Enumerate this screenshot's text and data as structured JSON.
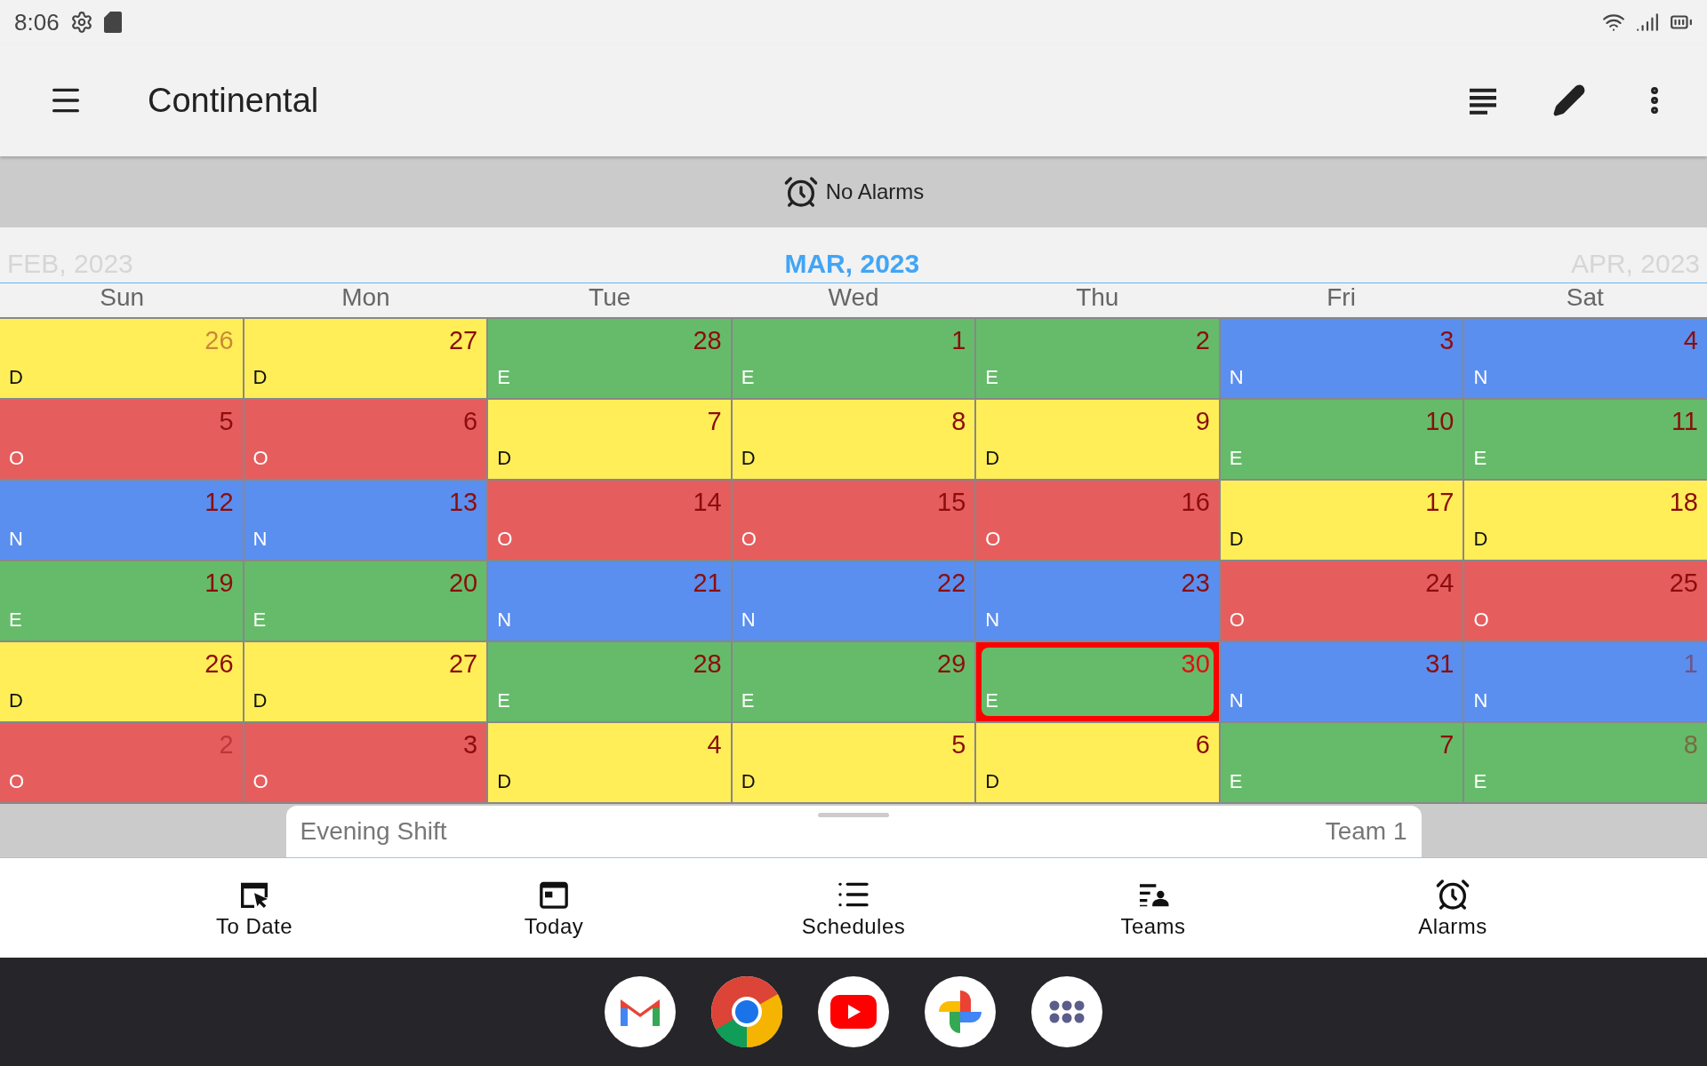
{
  "status_bar": {
    "time": "8:06"
  },
  "app_bar": {
    "title": "Continental"
  },
  "alarm_banner": {
    "text": "No Alarms"
  },
  "month_header": {
    "previous": "FEB, 2023",
    "current": "MAR, 2023",
    "next": "APR, 2023"
  },
  "weekdays": [
    "Sun",
    "Mon",
    "Tue",
    "Wed",
    "Thu",
    "Fri",
    "Sat"
  ],
  "days": [
    {
      "day": "26",
      "shift": "D",
      "color": "#ffee58",
      "faded": true,
      "selected": false
    },
    {
      "day": "27",
      "shift": "D",
      "color": "#ffee58",
      "faded": false,
      "selected": false
    },
    {
      "day": "28",
      "shift": "E",
      "color": "#66bb6a",
      "faded": false,
      "selected": false
    },
    {
      "day": "1",
      "shift": "E",
      "color": "#66bb6a",
      "faded": false,
      "selected": false
    },
    {
      "day": "2",
      "shift": "E",
      "color": "#66bb6a",
      "faded": false,
      "selected": false
    },
    {
      "day": "3",
      "shift": "N",
      "color": "#5a8fef",
      "faded": false,
      "selected": false
    },
    {
      "day": "4",
      "shift": "N",
      "color": "#5a8fef",
      "faded": false,
      "selected": false
    },
    {
      "day": "5",
      "shift": "O",
      "color": "#e65d5d",
      "faded": false,
      "selected": false
    },
    {
      "day": "6",
      "shift": "O",
      "color": "#e65d5d",
      "faded": false,
      "selected": false
    },
    {
      "day": "7",
      "shift": "D",
      "color": "#ffee58",
      "faded": false,
      "selected": false
    },
    {
      "day": "8",
      "shift": "D",
      "color": "#ffee58",
      "faded": false,
      "selected": false
    },
    {
      "day": "9",
      "shift": "D",
      "color": "#ffee58",
      "faded": false,
      "selected": false
    },
    {
      "day": "10",
      "shift": "E",
      "color": "#66bb6a",
      "faded": false,
      "selected": false
    },
    {
      "day": "11",
      "shift": "E",
      "color": "#66bb6a",
      "faded": false,
      "selected": false
    },
    {
      "day": "12",
      "shift": "N",
      "color": "#5a8fef",
      "faded": false,
      "selected": false
    },
    {
      "day": "13",
      "shift": "N",
      "color": "#5a8fef",
      "faded": false,
      "selected": false
    },
    {
      "day": "14",
      "shift": "O",
      "color": "#e65d5d",
      "faded": false,
      "selected": false
    },
    {
      "day": "15",
      "shift": "O",
      "color": "#e65d5d",
      "faded": false,
      "selected": false
    },
    {
      "day": "16",
      "shift": "O",
      "color": "#e65d5d",
      "faded": false,
      "selected": false
    },
    {
      "day": "17",
      "shift": "D",
      "color": "#ffee58",
      "faded": false,
      "selected": false
    },
    {
      "day": "18",
      "shift": "D",
      "color": "#ffee58",
      "faded": false,
      "selected": false
    },
    {
      "day": "19",
      "shift": "E",
      "color": "#66bb6a",
      "faded": false,
      "selected": false
    },
    {
      "day": "20",
      "shift": "E",
      "color": "#66bb6a",
      "faded": false,
      "selected": false
    },
    {
      "day": "21",
      "shift": "N",
      "color": "#5a8fef",
      "faded": false,
      "selected": false
    },
    {
      "day": "22",
      "shift": "N",
      "color": "#5a8fef",
      "faded": false,
      "selected": false
    },
    {
      "day": "23",
      "shift": "N",
      "color": "#5a8fef",
      "faded": false,
      "selected": false
    },
    {
      "day": "24",
      "shift": "O",
      "color": "#e65d5d",
      "faded": false,
      "selected": false
    },
    {
      "day": "25",
      "shift": "O",
      "color": "#e65d5d",
      "faded": false,
      "selected": false
    },
    {
      "day": "26",
      "shift": "D",
      "color": "#ffee58",
      "faded": false,
      "selected": false
    },
    {
      "day": "27",
      "shift": "D",
      "color": "#ffee58",
      "faded": false,
      "selected": false
    },
    {
      "day": "28",
      "shift": "E",
      "color": "#66bb6a",
      "faded": false,
      "selected": false
    },
    {
      "day": "29",
      "shift": "E",
      "color": "#66bb6a",
      "faded": false,
      "selected": false
    },
    {
      "day": "30",
      "shift": "E",
      "color": "#66bb6a",
      "faded": false,
      "selected": true
    },
    {
      "day": "31",
      "shift": "N",
      "color": "#5a8fef",
      "faded": false,
      "selected": false
    },
    {
      "day": "1",
      "shift": "N",
      "color": "#5a8fef",
      "faded": true,
      "selected": false
    },
    {
      "day": "2",
      "shift": "O",
      "color": "#e65d5d",
      "faded": true,
      "selected": false
    },
    {
      "day": "3",
      "shift": "O",
      "color": "#e65d5d",
      "faded": false,
      "selected": false
    },
    {
      "day": "4",
      "shift": "D",
      "color": "#ffee58",
      "faded": false,
      "selected": false
    },
    {
      "day": "5",
      "shift": "D",
      "color": "#ffee58",
      "faded": false,
      "selected": false
    },
    {
      "day": "6",
      "shift": "D",
      "color": "#ffee58",
      "faded": false,
      "selected": false
    },
    {
      "day": "7",
      "shift": "E",
      "color": "#66bb6a",
      "faded": false,
      "selected": false
    },
    {
      "day": "8",
      "shift": "E",
      "color": "#66bb6a",
      "faded": true,
      "selected": false
    }
  ],
  "bottom_sheet": {
    "shift_name": "Evening Shift",
    "team": "Team 1"
  },
  "nav": [
    {
      "label": "To Date",
      "kind": "todate"
    },
    {
      "label": "Today",
      "kind": "today"
    },
    {
      "label": "Schedules",
      "kind": "schedules"
    },
    {
      "label": "Teams",
      "kind": "teams"
    },
    {
      "label": "Alarms",
      "kind": "alarms"
    }
  ],
  "dock": [
    {
      "kind": "mail"
    },
    {
      "kind": "browser"
    },
    {
      "kind": "video"
    },
    {
      "kind": "photos"
    },
    {
      "kind": "apps"
    }
  ]
}
